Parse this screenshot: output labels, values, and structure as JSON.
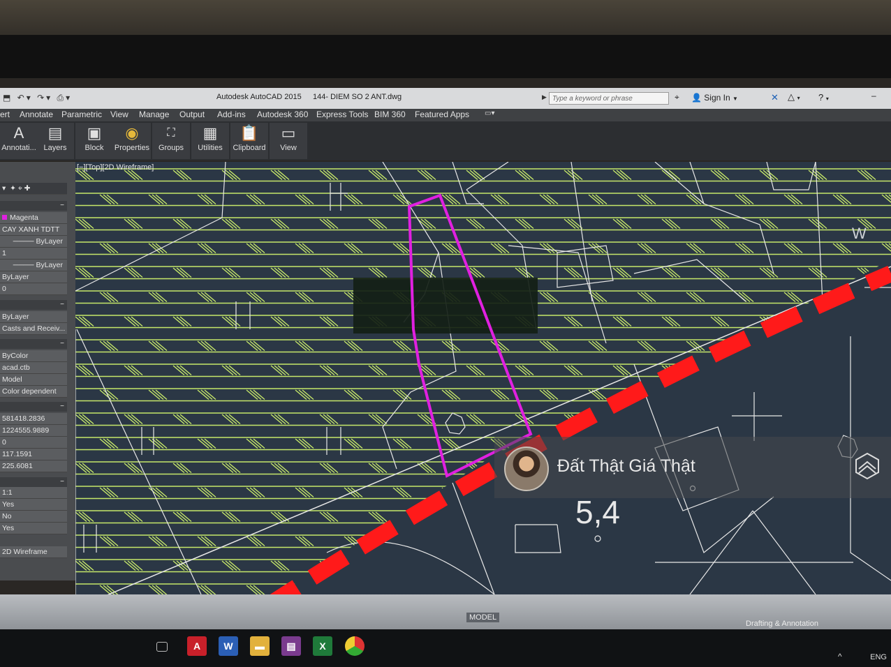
{
  "window": {
    "app_title": "Autodesk AutoCAD 2015",
    "document_title": "144- DIEM SO 2 ANT.dwg",
    "search_placeholder": "Type a keyword or phrase",
    "sign_in": "Sign In"
  },
  "ribbon": {
    "tabs": [
      "ert",
      "Annotate",
      "Parametric",
      "View",
      "Manage",
      "Output",
      "Add-ins",
      "Autodesk 360",
      "Express Tools",
      "BIM 360",
      "Featured Apps"
    ],
    "panels": [
      "Annotati...",
      "Layers",
      "Block",
      "Properties",
      "Groups",
      "Utilities",
      "Clipboard",
      "View"
    ]
  },
  "viewport": {
    "label": "[−][Top][2D Wireframe]",
    "drawing_text": "5,4",
    "compass_letter": "W"
  },
  "properties": {
    "general": [
      "Magenta",
      "CAY XANH TDTT",
      "ByLayer",
      "1",
      "ByLayer",
      "ByLayer",
      "0"
    ],
    "material": [
      "ByLayer",
      "Casts and Receiv..."
    ],
    "plot": [
      "ByColor",
      "acad.ctb",
      "Model",
      "Color dependent"
    ],
    "view": [
      "581418.2836",
      "1224555.9889",
      "0",
      "117.1591",
      "225.6081"
    ],
    "misc": [
      "1:1",
      "Yes",
      "No",
      "Yes",
      "2D Wireframe"
    ]
  },
  "statusbar": {
    "model_tab": "MODEL",
    "workspace": "Drafting & Annotation"
  },
  "taskbar": {
    "language": "ENG",
    "apps": [
      "task-view",
      "autocad",
      "word",
      "file-explorer",
      "winrar",
      "excel",
      "chrome"
    ]
  },
  "watermark": {
    "text": "Đất Thật Giá Thật"
  },
  "colors": {
    "selection": "#e020e0",
    "boundary": "#ff1a1a",
    "hatch": "#c6e86a",
    "lines": "#e8e8e8",
    "model_space": "#2b3745"
  }
}
